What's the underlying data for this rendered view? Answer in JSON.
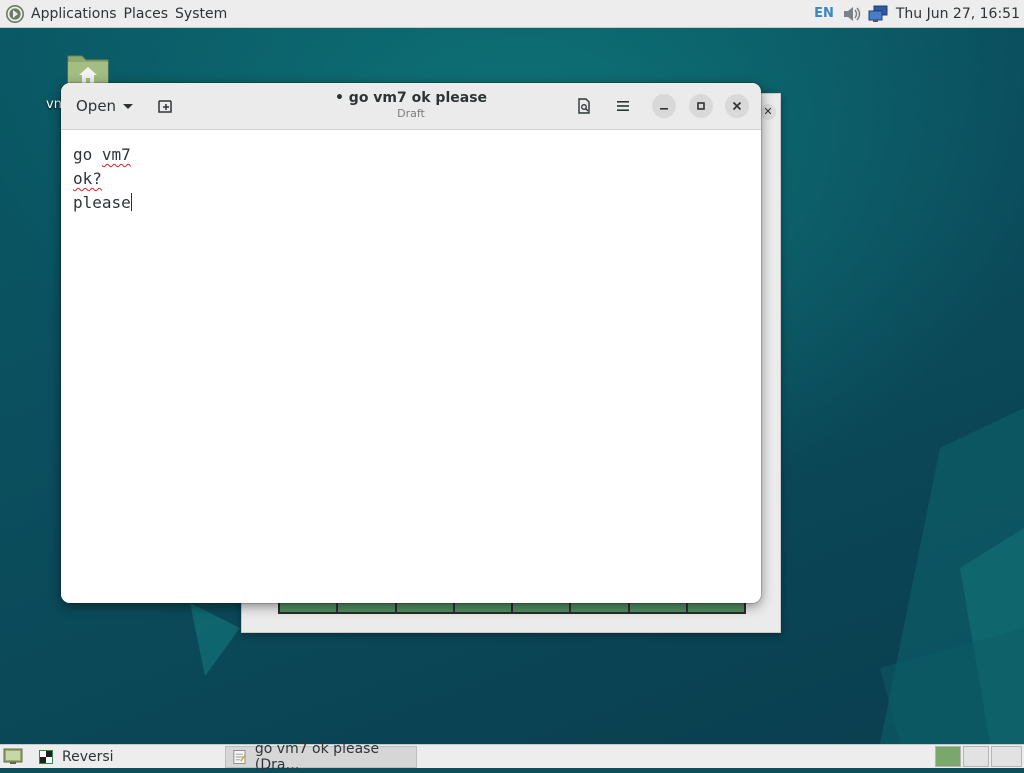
{
  "top_panel": {
    "menus": [
      "Applications",
      "Places",
      "System"
    ],
    "keyboard_layout": "EN",
    "clock": "Thu Jun 27, 16:51"
  },
  "desktop": {
    "home_icon_label": "vn"
  },
  "gedit": {
    "open_label": "Open",
    "title": "• go vm7 ok please",
    "subtitle": "Draft",
    "lines": {
      "line1_word1": "go",
      "line1_word2": "vm7",
      "line2": "ok?",
      "line3": "please"
    }
  },
  "taskbar": {
    "tasks": [
      "Reversi",
      "go vm7 ok please (Dra…"
    ]
  },
  "colors": {
    "desktop_teal": "#0b4f5c",
    "board_green": "#4f8f61",
    "spell_error": "#e01b24"
  }
}
